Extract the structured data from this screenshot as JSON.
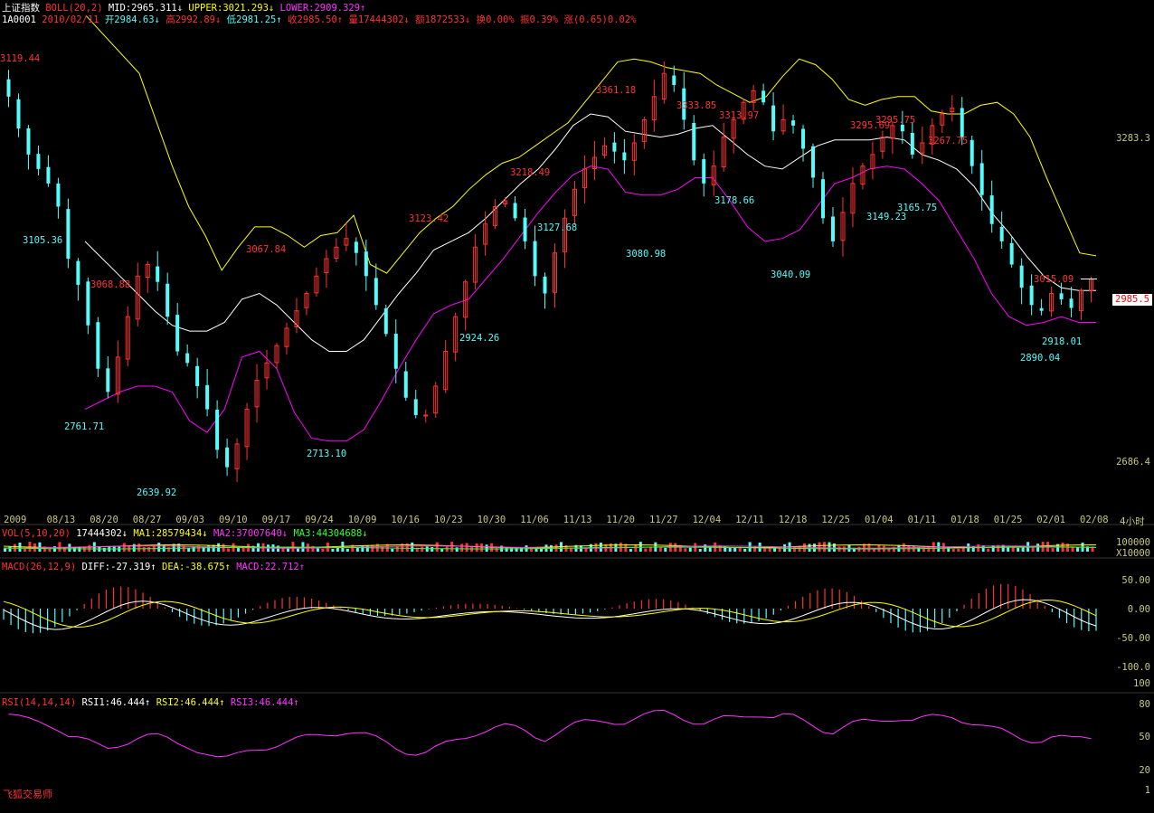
{
  "header": {
    "index_name": "上证指数",
    "indicator": "BOLL(20,2)",
    "mid": "MID:2965.311↓",
    "upper": "UPPER:3021.293↓",
    "lower": "LOWER:2909.329↑",
    "code": "1A0001",
    "date": "2010/02/11",
    "open": "开2984.63↓",
    "high": "高2992.89↓",
    "low": "低2981.25↑",
    "close": "收2985.50↑",
    "volume": "量17444302↓",
    "amount": "额1872533↓",
    "turnover": "换0.00%",
    "amplitude": "振0.39%",
    "change": "涨(0.65)0.02%"
  },
  "price_tag": "2985.5",
  "price_axis": {
    "top": "3283.3",
    "bottom": "2686.4"
  },
  "period_label": "4小时",
  "date_axis": [
    "2009",
    "08/13",
    "08/20",
    "08/27",
    "09/03",
    "09/10",
    "09/17",
    "09/24",
    "10/09",
    "10/16",
    "10/23",
    "10/30",
    "11/06",
    "11/13",
    "11/20",
    "11/27",
    "12/04",
    "12/11",
    "12/18",
    "12/25",
    "01/04",
    "01/11",
    "01/18",
    "01/25",
    "02/01",
    "02/08"
  ],
  "volume_panel": {
    "title": "VOL(5,10,20)",
    "vol": "17444302↓",
    "ma1": "MA1:28579434↓",
    "ma2": "MA2:37007640↓",
    "ma3": "MA3:44304688↓",
    "axis_top": "100000",
    "axis_unit": "X10000"
  },
  "macd_panel": {
    "title": "MACD(26,12,9)",
    "diff": "DIFF:-27.319↑",
    "dea": "DEA:-38.675↑",
    "macd": "MACD:22.712↑",
    "axis": [
      "50.00",
      "0.00",
      "-50.00",
      "-100.0"
    ]
  },
  "rsi_panel": {
    "title": "RSI(14,14,14)",
    "rsi1": "RSI1:46.444↑",
    "rsi2": "RSI2:46.444↑",
    "rsi3": "RSI3:46.444↑",
    "axis": [
      "100",
      "80",
      "50",
      "20",
      "1"
    ]
  },
  "footer": "飞狐交易师",
  "colors": {
    "up": "#ff3232",
    "down": "#54fcfc",
    "mid": "#ffffff",
    "upper": "#ffff00",
    "lower": "#ff00ff",
    "axis": "#c8c880"
  },
  "chart_data": {
    "type": "candlestick",
    "price_annotations": {
      "highs": [
        "3119.44",
        "3068.88",
        "3067.84",
        "3123.42",
        "3218.49",
        "3361.18",
        "3333.85",
        "3313.97",
        "3295.69",
        "3295.75",
        "3267.75",
        "3015.09"
      ],
      "lows": [
        "3105.36",
        "2761.71",
        "2639.92",
        "2713.10",
        "2924.26",
        "3127.68",
        "3080.98",
        "3178.66",
        "3040.09",
        "3149.23",
        "3165.75",
        "2918.01",
        "2890.04"
      ]
    },
    "closes": [
      3300,
      3245,
      3200,
      3175,
      3150,
      3110,
      3020,
      2975,
      2905,
      2830,
      2790,
      2850,
      2920,
      2990,
      3010,
      2980,
      2920,
      2860,
      2840,
      2800,
      2760,
      2690,
      2660,
      2700,
      2760,
      2810,
      2840,
      2870,
      2900,
      2930,
      2960,
      2990,
      3020,
      3040,
      3055,
      3030,
      2990,
      2940,
      2890,
      2830,
      2780,
      2750,
      2750,
      2800,
      2860,
      2920,
      2980,
      3040,
      3080,
      3110,
      3120,
      3090,
      3050,
      2990,
      2960,
      3030,
      3090,
      3140,
      3175,
      3195,
      3215,
      3205,
      3190,
      3220,
      3260,
      3300,
      3340,
      3320,
      3260,
      3190,
      3150,
      3180,
      3230,
      3260,
      3290,
      3310,
      3290,
      3240,
      3260,
      3250,
      3210,
      3160,
      3090,
      3050,
      3100,
      3150,
      3180,
      3200,
      3230,
      3250,
      3240,
      3200,
      3220,
      3250,
      3270,
      3280,
      3230,
      3180,
      3130,
      3080,
      3050,
      3010,
      2970,
      2940,
      2930,
      2960,
      2950,
      2935,
      2965,
      2985
    ],
    "upper": [
      3340,
      3260,
      3180,
      3110,
      3060,
      3000,
      3040,
      3075,
      3075,
      3060,
      3040,
      3060,
      3065,
      3095,
      3010,
      2995,
      3030,
      3065,
      3090,
      3110,
      3140,
      3165,
      3185,
      3195,
      3215,
      3235,
      3255,
      3290,
      3325,
      3360,
      3365,
      3360,
      3350,
      3345,
      3340,
      3320,
      3305,
      3290,
      3300,
      3335,
      3365,
      3355,
      3330,
      3295,
      3285,
      3295,
      3300,
      3300,
      3275,
      3270,
      3270,
      3285,
      3290,
      3270,
      3230,
      3160,
      3095,
      3030,
      3025
    ],
    "mid": [
      3050,
      3020,
      2990,
      2960,
      2930,
      2905,
      2895,
      2895,
      2910,
      2950,
      2960,
      2940,
      2910,
      2880,
      2860,
      2860,
      2880,
      2920,
      2960,
      2995,
      3035,
      3050,
      3065,
      3090,
      3120,
      3150,
      3175,
      3210,
      3250,
      3270,
      3265,
      3240,
      3235,
      3230,
      3235,
      3245,
      3250,
      3225,
      3200,
      3180,
      3175,
      3195,
      3215,
      3225,
      3225,
      3225,
      3230,
      3225,
      3200,
      3190,
      3175,
      3145,
      3100,
      3065,
      3025,
      2990,
      2970,
      2965,
      2965
    ],
    "lower": [
      2760,
      2775,
      2790,
      2800,
      2800,
      2790,
      2740,
      2720,
      2760,
      2850,
      2860,
      2830,
      2755,
      2710,
      2705,
      2705,
      2725,
      2775,
      2830,
      2880,
      2925,
      2940,
      2950,
      2985,
      3020,
      3060,
      3100,
      3135,
      3165,
      3180,
      3175,
      3135,
      3130,
      3130,
      3140,
      3160,
      3160,
      3120,
      3075,
      3050,
      3055,
      3070,
      3110,
      3150,
      3160,
      3175,
      3180,
      3175,
      3150,
      3120,
      3070,
      3020,
      2960,
      2920,
      2905,
      2910,
      2920,
      2910,
      2910
    ]
  }
}
